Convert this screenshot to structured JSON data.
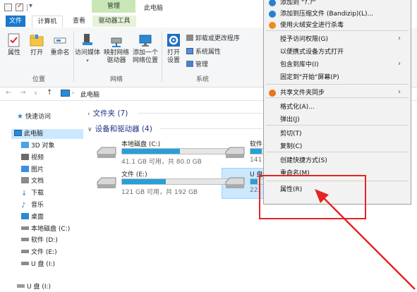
{
  "window": {
    "title": "此电脑",
    "contextual_header": "管理"
  },
  "tabs": {
    "file": "文件",
    "computer": "计算机",
    "view": "查看",
    "drive_tools": "驱动器工具"
  },
  "ribbon": {
    "location": {
      "properties": "属性",
      "open": "打开",
      "rename": "重命名",
      "group": "位置"
    },
    "network": {
      "access_media": "访问媒体",
      "map_drive_1": "映射网络",
      "map_drive_2": "驱动器",
      "add_location_1": "添加一个",
      "add_location_2": "网络位置",
      "group": "网络"
    },
    "system": {
      "open_settings_1": "打开",
      "open_settings_2": "设置",
      "uninstall": "卸载或更改程序",
      "sys_props": "系统属性",
      "manage": "管理",
      "group": "系统"
    }
  },
  "address": {
    "path": "此电脑"
  },
  "nav": {
    "quick_access": "快速访问",
    "this_pc": "此电脑",
    "items": [
      "3D 对象",
      "视频",
      "图片",
      "文档",
      "下载",
      "音乐",
      "桌面",
      "本地磁盘 (C:)",
      "软件 (D:)",
      "文件 (E:)",
      "U 盘 (I:)"
    ],
    "usb_root": "U 盘 (I:)"
  },
  "content": {
    "folders_header": "文件夹 (7)",
    "devices_header": "设备和驱动器 (4)",
    "drives": [
      {
        "name": "本地磁盘 (C:)",
        "free": "41.1 GB 可用，共 80.0 GB",
        "used_fraction": 0.49
      },
      {
        "name": "软件",
        "free": "141",
        "used_fraction": 0.3
      },
      {
        "name": "文件 (E:)",
        "free": "121 GB 可用，共 192 GB",
        "used_fraction": 0.37
      },
      {
        "name": "U 盘",
        "free": "22.",
        "used_fraction": 0.2
      }
    ]
  },
  "context_menu": {
    "items": {
      "top_partial": "添加到 \"?.?\"",
      "bandizip": "添加到压缩文件 (Bandizip)(L)...",
      "huorong": "使用火绒安全进行杀毒",
      "grant_access": "授予访问权限(G)",
      "portable": "以便携式设备方式打开",
      "library": "包含到库中(I)",
      "pin_start": "固定到\"开始\"屏幕(P)",
      "share_sync": "共享文件夹同步",
      "format": "格式化(A)...",
      "eject": "弹出(J)",
      "cut": "剪切(T)",
      "copy": "复制(C)",
      "shortcut": "创建快捷方式(S)",
      "rename": "重命名(M)",
      "properties": "属性(R)"
    }
  },
  "colors": {
    "accent": "#1979ca",
    "annotation": "#e52323",
    "selection": "#cce8ff",
    "drive_bar": "#26a0da"
  }
}
